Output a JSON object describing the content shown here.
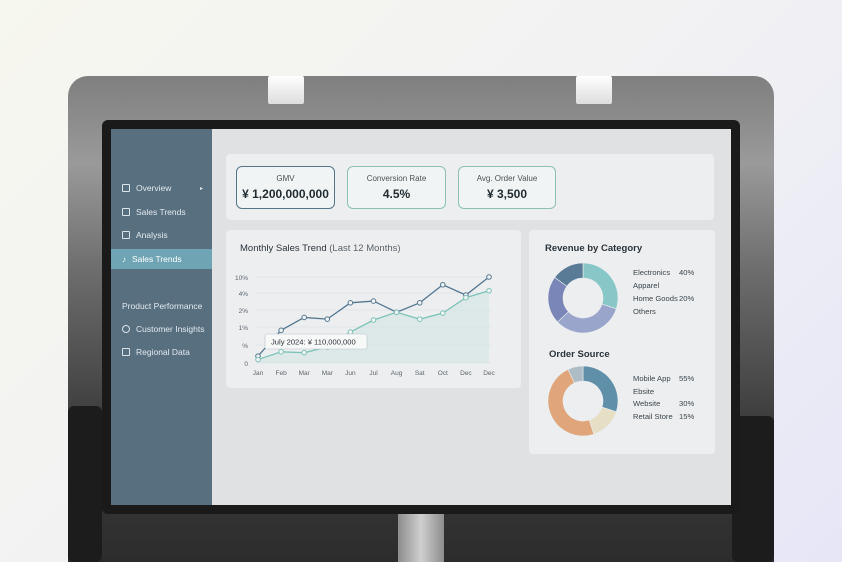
{
  "sidebar": {
    "items": [
      {
        "label": "Overview",
        "caret": "▸"
      },
      {
        "label": "Sales Trends"
      },
      {
        "label": "Analysis"
      },
      {
        "label": "Sales Trends",
        "active": true
      },
      {
        "label": "Product Performance"
      },
      {
        "label": "Customer Insights"
      },
      {
        "label": "Regional Data"
      }
    ]
  },
  "kpis": [
    {
      "label": "GMV",
      "value": "¥ 1,200,000,000"
    },
    {
      "label": "Conversion Rate",
      "value": "4.5%"
    },
    {
      "label": "Avg. Order Value",
      "value": "¥ 3,500"
    }
  ],
  "trend": {
    "title": "Monthly Sales Trend",
    "subtitle": "(Last 12 Months)",
    "tooltip": "July 2024: ¥ 110,000,000"
  },
  "revenue": {
    "title": "Revenue by Category",
    "legend": [
      {
        "label": "Electronics",
        "pct": "40%"
      },
      {
        "label": "Apparel",
        "pct": ""
      },
      {
        "label": "Home Goods",
        "pct": "20%"
      },
      {
        "label": "Others",
        "pct": ""
      }
    ]
  },
  "source": {
    "title": "Order Source",
    "legend": [
      {
        "label": "Mobile App",
        "pct": "55%"
      },
      {
        "label": "Ebsite",
        "pct": ""
      },
      {
        "label": "Website",
        "pct": "30%"
      },
      {
        "label": "Retail Store",
        "pct": "15%"
      }
    ]
  },
  "colors": {
    "sidebar": "#586f80",
    "active": "#6fa4b4",
    "series_dark": "#557891",
    "series_light": "#7cc3b8"
  },
  "chart_data": [
    {
      "type": "line",
      "title": "Monthly Sales Trend",
      "subtitle": "(Last 12 Months)",
      "categories": [
        "Jan",
        "Feb",
        "Mar",
        "Mar",
        "Jun",
        "Jul",
        "Aug",
        "Sat",
        "Oct",
        "Dec",
        "Dec"
      ],
      "y_ticks": [
        "0",
        "%",
        "1%",
        "2%",
        "4%",
        "10%"
      ],
      "series": [
        {
          "values": [
            0.4,
            1.9,
            2.65,
            2.55,
            3.5,
            3.6,
            2.95,
            3.5,
            4.55,
            3.95,
            5.0
          ]
        },
        {
          "values": [
            0.2,
            0.65,
            0.6,
            0.93,
            1.8,
            2.5,
            2.95,
            2.55,
            2.9,
            3.8,
            4.2
          ]
        }
      ],
      "grid": true
    },
    {
      "type": "pie",
      "title": "Revenue by Category",
      "labels": [
        "Electronics",
        "Apparel",
        "Home Goods",
        "Others"
      ],
      "values": [
        30,
        33,
        22,
        15
      ],
      "colors": [
        "#88c7c7",
        "#9aa5cc",
        "#7b86b8",
        "#5a7b95"
      ]
    },
    {
      "type": "pie",
      "title": "Order Source",
      "labels": [
        "Mobile App",
        "Website",
        "Retail Store",
        "Ebsite"
      ],
      "values": [
        30,
        15,
        48,
        7
      ],
      "colors": [
        "#5f8fa9",
        "#e6dfc5",
        "#e0a57a",
        "#aebdc5"
      ]
    }
  ]
}
